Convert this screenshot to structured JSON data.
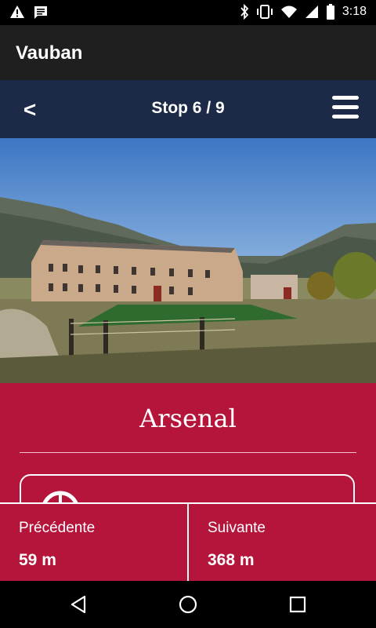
{
  "status_bar": {
    "time": "3:18",
    "left_icons": [
      "warning-icon",
      "message-icon"
    ],
    "right_icons": [
      "bluetooth-icon",
      "vibrate-icon",
      "wifi-icon",
      "signal-icon",
      "battery-icon"
    ]
  },
  "app": {
    "title": "Vauban"
  },
  "nav": {
    "back_label": "<",
    "title": "Stop 6 / 9",
    "menu_icon": "hamburger-menu-icon"
  },
  "stop": {
    "name": "Arsenal"
  },
  "card": {
    "icon": "compass-icon"
  },
  "footer": {
    "prev": {
      "label": "Précédente",
      "distance": "59 m"
    },
    "next": {
      "label": "Suivante",
      "distance": "368 m"
    }
  },
  "system_nav": {
    "icons": [
      "back-triangle-icon",
      "home-circle-icon",
      "recents-square-icon"
    ]
  },
  "colors": {
    "accent": "#b5153b",
    "nav": "#1c2a48",
    "app_bar": "#1f1f1f"
  }
}
